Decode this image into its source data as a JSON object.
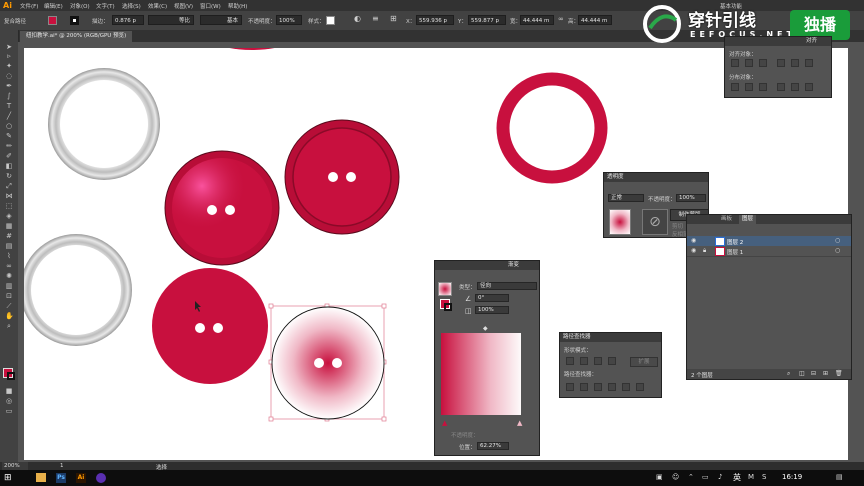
{
  "app": {
    "logo": "Ai",
    "workspace": "基本功能"
  },
  "menu": [
    "文件(F)",
    "编辑(E)",
    "对象(O)",
    "文字(T)",
    "选择(S)",
    "效果(C)",
    "视图(V)",
    "窗口(W)",
    "帮助(H)"
  ],
  "control_bar": {
    "selection_label": "复合路径",
    "stroke_label": "描边：",
    "stroke_value": "0.876 p",
    "stroke_profile": "等比",
    "brush": "基本",
    "opacity_label": "不透明度：",
    "opacity_value": "100%",
    "style_label": "样式：",
    "x_label": "X：",
    "x_value": "559.936 p",
    "y_label": "Y：",
    "y_value": "559.877 p",
    "w_label": "宽：",
    "w_value": "44.444 m",
    "h_label": "高：",
    "h_value": "44.444 m"
  },
  "document": {
    "tab": "纽扣教学.ai* @ 200% (RGB/GPU 预览)"
  },
  "watermark": {
    "brand": "穿针引线",
    "sub": "EEFOCUS.NET",
    "badge": "独播"
  },
  "panels": {
    "align": {
      "tab": "对齐",
      "align_objects": "对齐对象：",
      "distribute_objects": "分布对象："
    },
    "transparency": {
      "title": "透明度",
      "mode": "正常",
      "opacity_label": "不透明度：",
      "opacity": "100%",
      "make_mask": "制作蒙版",
      "clip": "剪切",
      "invert": "反相蒙版"
    },
    "layers": {
      "tabs": [
        "画板",
        "图层"
      ],
      "items": [
        "图层 2",
        "图层 1"
      ],
      "footer": "2 个图层"
    },
    "gradient": {
      "title": "渐变",
      "type_label": "类型：",
      "type": "径向",
      "angle": "0°",
      "aspect": "100%",
      "opacity_label": "不透明度：",
      "position_label": "位置：",
      "position": "62.27%"
    },
    "pathfinder": {
      "title": "路径查找器",
      "shape_modes": "形状模式：",
      "expand": "扩展",
      "pathfinders": "路径查找器："
    }
  },
  "status": {
    "zoom": "200%",
    "artboard": "1",
    "tool": "选择"
  },
  "taskbar": {
    "ime": "英",
    "time": "16:19"
  },
  "colors": {
    "accent": "#c8103e",
    "badge": "#1a9c3a",
    "canvas": "#ffffff",
    "ui_bg": "#535353"
  }
}
